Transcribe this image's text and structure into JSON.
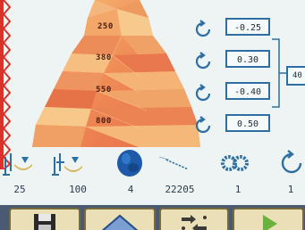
{
  "layers": [
    {
      "label": "250"
    },
    {
      "label": "380"
    },
    {
      "label": "550"
    },
    {
      "label": "800"
    }
  ],
  "offsets": [
    {
      "value": "-0.25"
    },
    {
      "value": "0.30"
    },
    {
      "value": "-0.40"
    },
    {
      "value": "0.50"
    }
  ],
  "side_value": "40",
  "stats": [
    {
      "value": "25"
    },
    {
      "value": "100"
    },
    {
      "value": "4"
    },
    {
      "value": "22205"
    },
    {
      "value": "1"
    },
    {
      "value": "1"
    }
  ],
  "icons": {
    "reset": "reset-arrow-icon",
    "tools": [
      "nozzle-single-icon",
      "nozzle-multi-icon",
      "blob-icon",
      "filament-icon",
      "gears-icon",
      "rotate-icon"
    ],
    "buttons": [
      "save-icon",
      "home-icon",
      "swap-icon",
      "play-icon"
    ]
  },
  "colors": {
    "accent": "#2d6ea3",
    "strip": "#e0302a",
    "mesh_base": "#f0a060",
    "button_bar": "#4a5a72"
  }
}
